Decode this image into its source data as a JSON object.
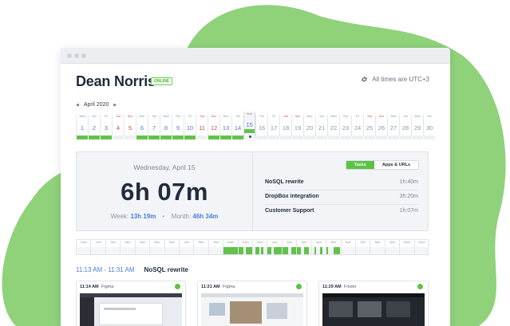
{
  "colors": {
    "accent_green": "#5cc246",
    "blue": "#4a7ed6",
    "weekend_red": "#d94848",
    "text_dark": "#1f2a3c"
  },
  "header": {
    "user_name": "Dean Norris",
    "status_badge": "ONLINE",
    "settings_icon": "gear-icon",
    "timezone_text": "All times are UTC+3"
  },
  "calendar": {
    "month_label": "April 2020",
    "prev_icon": "chevron-left-icon",
    "next_icon": "chevron-right-icon",
    "days": [
      {
        "dow": "Wed",
        "num": "1",
        "past": true,
        "weekend": false,
        "active": true
      },
      {
        "dow": "Thu",
        "num": "2",
        "past": true,
        "weekend": false,
        "active": true
      },
      {
        "dow": "Fri",
        "num": "3",
        "past": true,
        "weekend": false,
        "active": true
      },
      {
        "dow": "Sat",
        "num": "4",
        "past": true,
        "weekend": true,
        "active": false
      },
      {
        "dow": "Sun",
        "num": "5",
        "past": true,
        "weekend": true,
        "active": false
      },
      {
        "dow": "Mon",
        "num": "6",
        "past": true,
        "weekend": false,
        "active": true
      },
      {
        "dow": "Tue",
        "num": "7",
        "past": true,
        "weekend": false,
        "active": true
      },
      {
        "dow": "Wed",
        "num": "8",
        "past": true,
        "weekend": false,
        "active": true
      },
      {
        "dow": "Thu",
        "num": "9",
        "past": true,
        "weekend": false,
        "active": true
      },
      {
        "dow": "Fri",
        "num": "10",
        "past": true,
        "weekend": false,
        "active": true
      },
      {
        "dow": "Sat",
        "num": "11",
        "past": true,
        "weekend": true,
        "active": false
      },
      {
        "dow": "Sun",
        "num": "12",
        "past": true,
        "weekend": true,
        "active": true
      },
      {
        "dow": "Mon",
        "num": "13",
        "past": true,
        "weekend": false,
        "active": true
      },
      {
        "dow": "Tue",
        "num": "14",
        "past": true,
        "weekend": false,
        "active": true
      },
      {
        "dow": "Wed",
        "num": "15",
        "past": true,
        "weekend": false,
        "active": true,
        "today": true
      },
      {
        "dow": "Thu",
        "num": "16",
        "past": false,
        "weekend": false,
        "active": false
      },
      {
        "dow": "Fri",
        "num": "17",
        "past": false,
        "weekend": false,
        "active": false
      },
      {
        "dow": "Sat",
        "num": "18",
        "past": false,
        "weekend": true,
        "active": false
      },
      {
        "dow": "Sun",
        "num": "19",
        "past": false,
        "weekend": true,
        "active": false
      },
      {
        "dow": "Mon",
        "num": "20",
        "past": false,
        "weekend": false,
        "active": false
      },
      {
        "dow": "Tue",
        "num": "21",
        "past": false,
        "weekend": false,
        "active": false
      },
      {
        "dow": "Wed",
        "num": "22",
        "past": false,
        "weekend": false,
        "active": false
      },
      {
        "dow": "Thu",
        "num": "23",
        "past": false,
        "weekend": false,
        "active": false
      },
      {
        "dow": "Fri",
        "num": "24",
        "past": false,
        "weekend": false,
        "active": false
      },
      {
        "dow": "Sat",
        "num": "25",
        "past": false,
        "weekend": true,
        "active": false
      },
      {
        "dow": "Sun",
        "num": "26",
        "past": false,
        "weekend": true,
        "active": false
      },
      {
        "dow": "Mon",
        "num": "27",
        "past": false,
        "weekend": false,
        "active": false
      },
      {
        "dow": "Tue",
        "num": "28",
        "past": false,
        "weekend": false,
        "active": false
      },
      {
        "dow": "Wed",
        "num": "29",
        "past": false,
        "weekend": false,
        "active": false
      },
      {
        "dow": "Thu",
        "num": "30",
        "past": false,
        "weekend": false,
        "active": false
      }
    ]
  },
  "summary": {
    "date": "Wednesday, April 15",
    "total": "6h 07m",
    "week_label": "Week:",
    "week_value": "13h 19m",
    "month_label": "Month:",
    "month_value": "46h 34m",
    "separator": "•"
  },
  "tabs": [
    {
      "label": "Tasks",
      "active": true
    },
    {
      "label": "Apps & URLs",
      "active": false
    }
  ],
  "tasks": [
    {
      "name": "NoSQL rewrite",
      "time": "1h:40m"
    },
    {
      "name": "DropBox integration",
      "time": "3h:20m"
    },
    {
      "name": "Customer Support",
      "time": "1h:07m"
    }
  ],
  "timeline": {
    "hours": [
      "12am",
      "1am",
      "2am",
      "3am",
      "4am",
      "5am",
      "6am",
      "7am",
      "8am",
      "9am",
      "10am",
      "11am",
      "12pm",
      "1pm",
      "2pm",
      "3pm",
      "4pm",
      "5pm",
      "6pm",
      "7pm",
      "8pm",
      "9pm",
      "10pm",
      "11pm"
    ],
    "segments": [
      {
        "hour": 10,
        "start": 0.0,
        "end": 1.0
      },
      {
        "hour": 11,
        "start": 0.0,
        "end": 0.35
      },
      {
        "hour": 11,
        "start": 0.55,
        "end": 1.0
      },
      {
        "hour": 12,
        "start": 0.15,
        "end": 0.45
      },
      {
        "hour": 12,
        "start": 0.6,
        "end": 0.75
      },
      {
        "hour": 13,
        "start": 0.0,
        "end": 0.25
      },
      {
        "hour": 13,
        "start": 0.45,
        "end": 1.0
      },
      {
        "hour": 14,
        "start": 0.0,
        "end": 0.4
      },
      {
        "hour": 14,
        "start": 0.65,
        "end": 1.0
      },
      {
        "hour": 15,
        "start": 0.0,
        "end": 0.3
      },
      {
        "hour": 15,
        "start": 0.5,
        "end": 0.85
      },
      {
        "hour": 16,
        "start": 0.2,
        "end": 0.3
      },
      {
        "hour": 16,
        "start": 0.6,
        "end": 0.75
      },
      {
        "hour": 17,
        "start": 0.0,
        "end": 0.1
      },
      {
        "hour": 17,
        "start": 0.5,
        "end": 1.0
      }
    ]
  },
  "session": {
    "range": "11:13 AM - 11:31 AM",
    "task": "NoSQL rewrite"
  },
  "screenshots": [
    {
      "time": "11:14 AM",
      "app": "Figma"
    },
    {
      "time": "11:21 AM",
      "app": "Figma"
    },
    {
      "time": "11:29 AM",
      "app": "Finder"
    }
  ]
}
